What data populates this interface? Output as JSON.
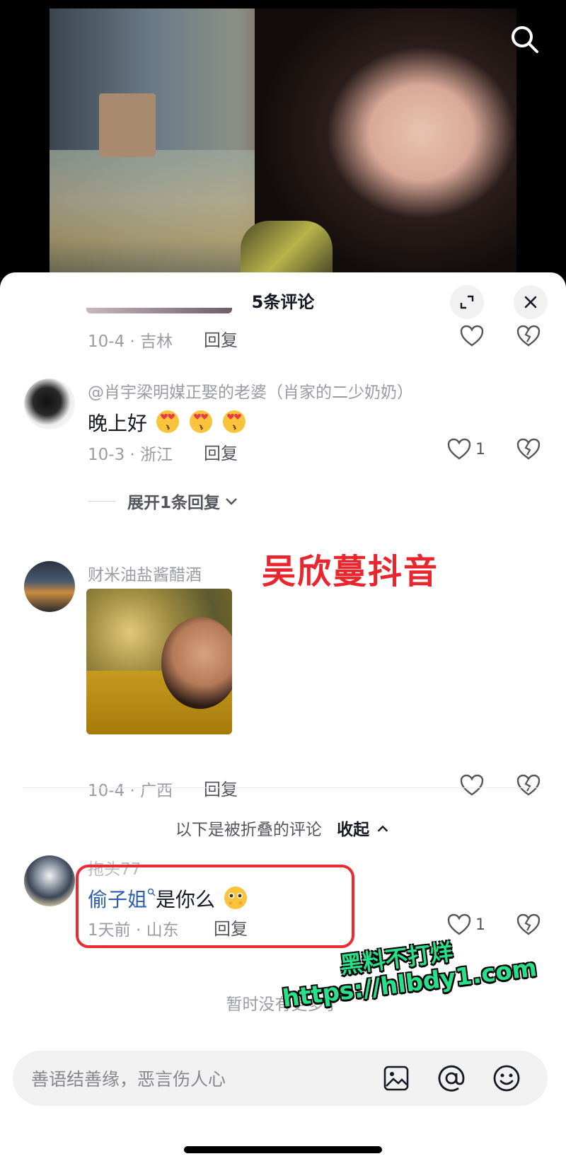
{
  "video": {
    "search_icon": "search-icon"
  },
  "sheet": {
    "title": "5条评论",
    "expand_icon": "expand-icon",
    "close_icon": "close-icon"
  },
  "comments": [
    {
      "date": "10-4 · 吉林",
      "reply_label": "回复",
      "like_count": ""
    },
    {
      "username": "@肖宇梁明媒正娶的老婆（肖家的二少奶奶）",
      "text": "晚上好",
      "emoji": "heart-eyes-kiss-emoji",
      "date": "10-3 · 浙江",
      "reply_label": "回复",
      "like_count": "1",
      "expand_label": "展开1条回复"
    },
    {
      "username": "财米油盐酱醋酒",
      "image": "sticker-image",
      "date": "10-4 · 广西",
      "reply_label": "回复",
      "like_count": ""
    },
    {
      "username": "拖头77",
      "mention": "偷子姐",
      "text": "是你么",
      "emoji": "pleading-emoji",
      "date": "1天前 · 山东",
      "reply_label": "回复",
      "like_count": "1"
    }
  ],
  "folded": {
    "label": "以下是被折叠的评论",
    "collapse_label": "收起"
  },
  "overlay": {
    "red_watermark": "吴欣蔓抖音",
    "green_line1": "黑料不打烊",
    "green_line2": "https://hlbdy1.com"
  },
  "end_text": "暂时没有更多了",
  "input": {
    "placeholder": "善语结善缘，恶言伤人心",
    "icons": [
      "image-icon",
      "at-icon",
      "emoji-icon"
    ]
  },
  "colors": {
    "accent_red": "#ea2b31",
    "green_watermark": "#29e08a",
    "mention_blue": "#2f5ea8"
  }
}
